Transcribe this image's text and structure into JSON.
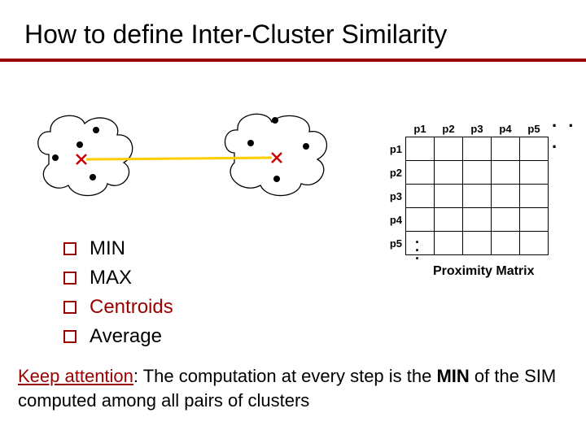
{
  "title": "How to define Inter-Cluster Similarity",
  "list": {
    "items": [
      {
        "label": "MIN",
        "highlight": false
      },
      {
        "label": "MAX",
        "highlight": false
      },
      {
        "label": "Centroids",
        "highlight": true
      },
      {
        "label": "Average",
        "highlight": false
      }
    ]
  },
  "matrix": {
    "col_labels": [
      "p1",
      "p2",
      "p3",
      "p4",
      "p5"
    ],
    "row_labels": [
      "p1",
      "p2",
      "p3",
      "p4",
      "p5"
    ],
    "ellipsis_h": ". . .",
    "ellipsis_v": ".\n.\n.",
    "caption": "Proximity Matrix"
  },
  "footer": {
    "lead": "Keep attention",
    "rest1": ": The computation at every step is the ",
    "bold": "MIN",
    "rest2": " of the SIM computed among all pairs of clusters"
  }
}
